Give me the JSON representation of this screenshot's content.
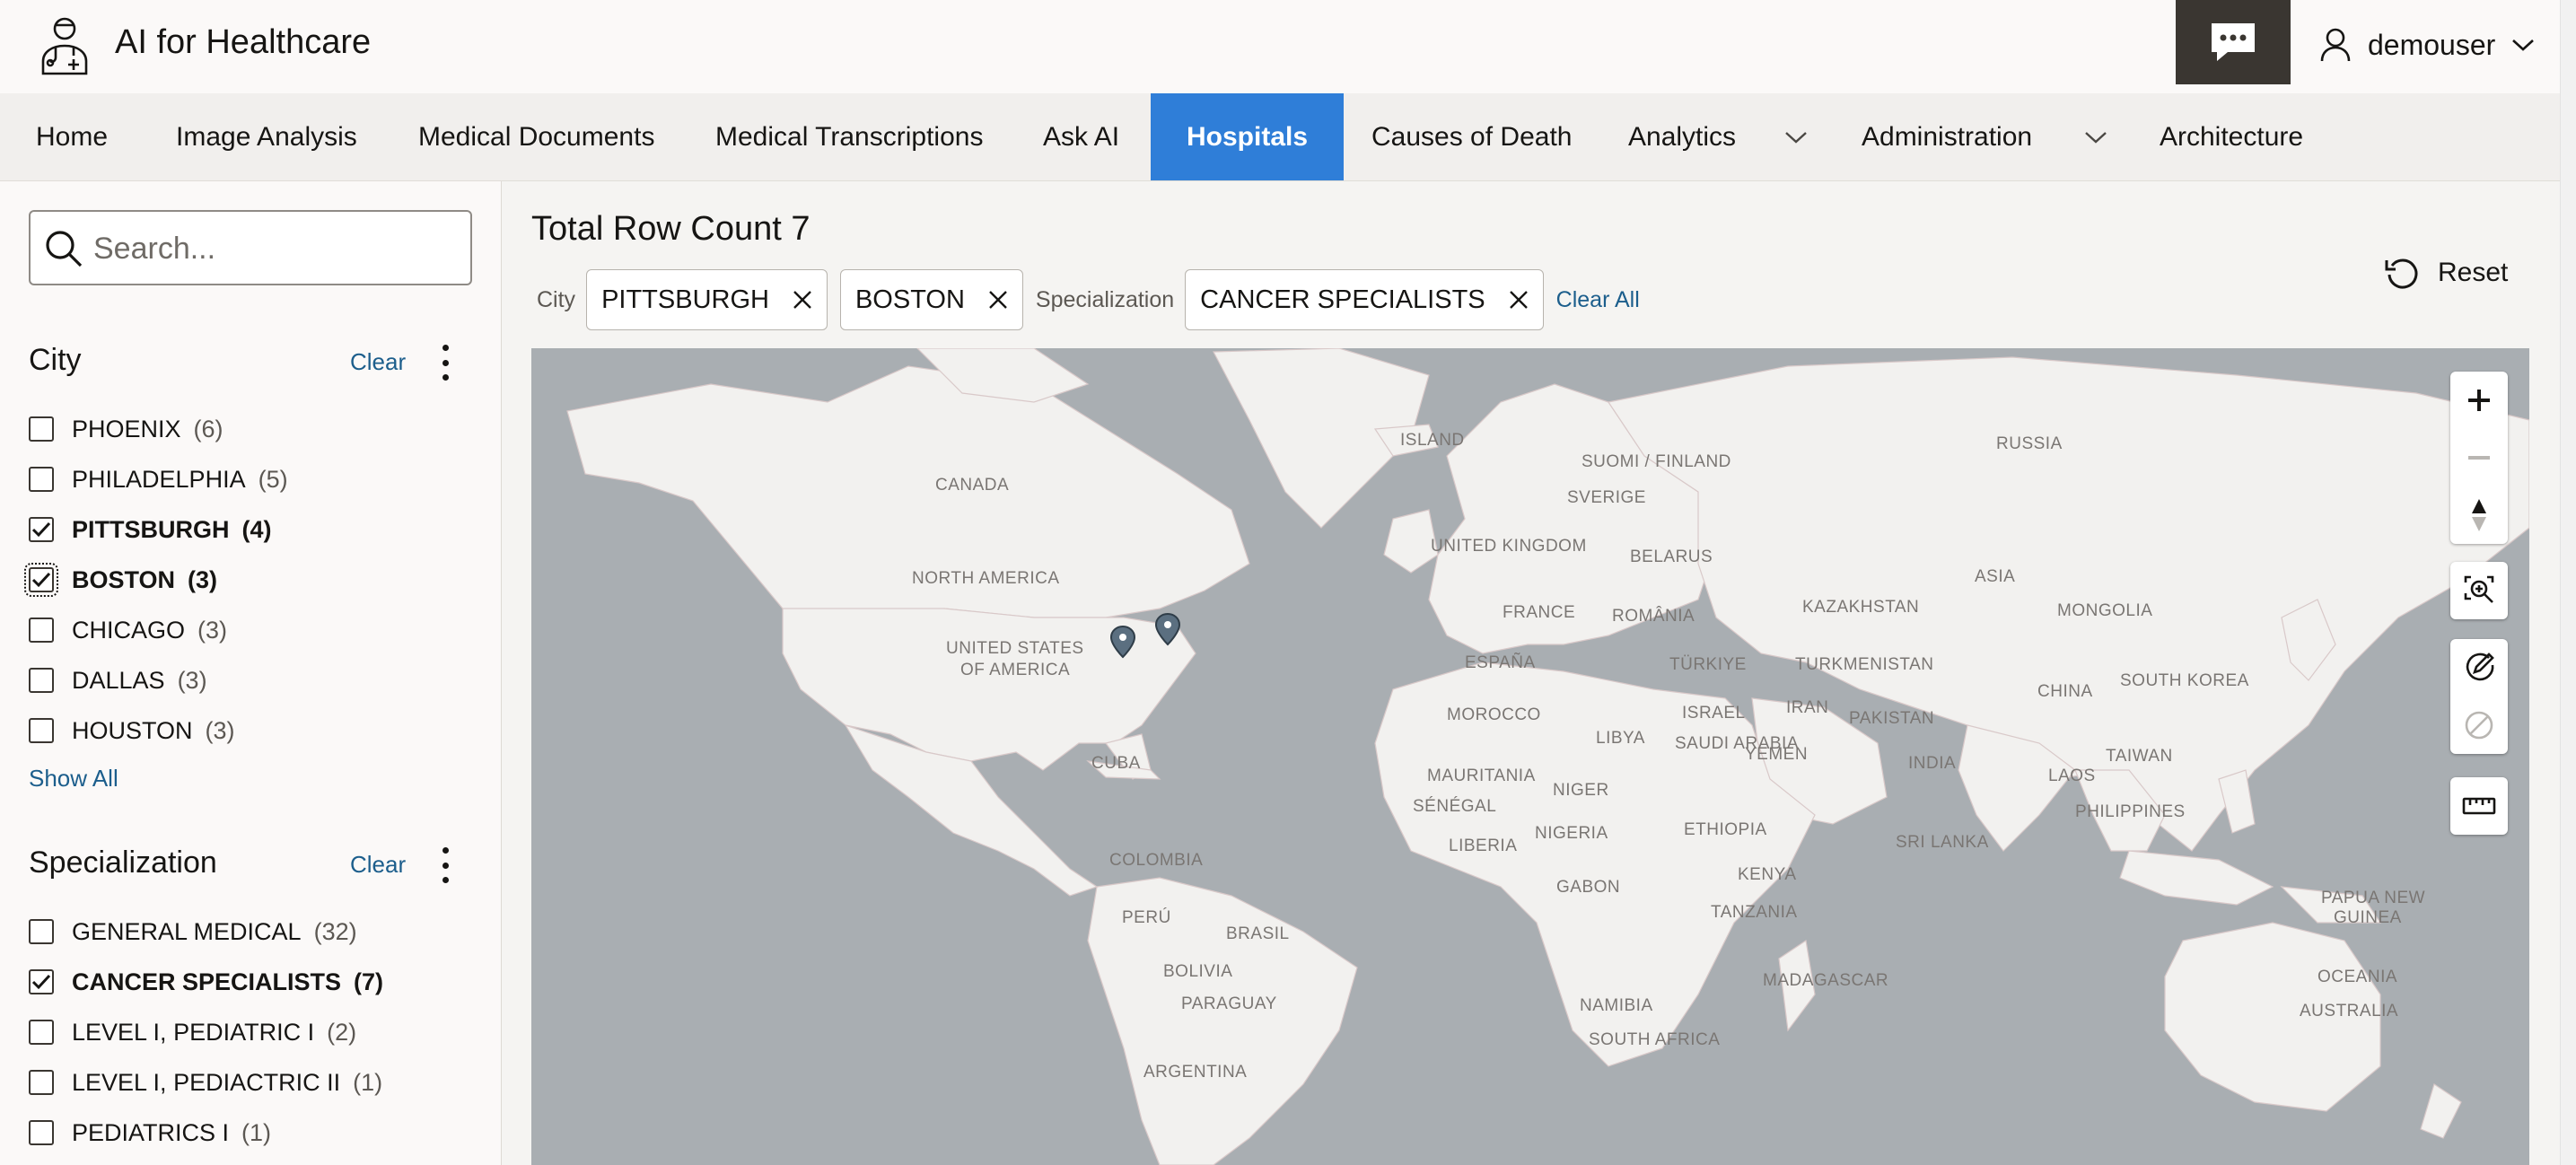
{
  "header": {
    "app_title": "AI for Healthcare",
    "user_name": "demouser",
    "logo_icon": "doctor-icon",
    "chat_icon": "chat-bubble-icon"
  },
  "nav": {
    "items": [
      {
        "label": "Home"
      },
      {
        "label": "Image Analysis"
      },
      {
        "label": "Medical Documents"
      },
      {
        "label": "Medical Transcriptions"
      },
      {
        "label": "Ask AI"
      },
      {
        "label": "Hospitals",
        "active": true
      },
      {
        "label": "Causes of Death"
      },
      {
        "label": "Analytics",
        "has_dropdown": true
      },
      {
        "label": "Administration",
        "has_dropdown": true
      },
      {
        "label": "Architecture"
      }
    ]
  },
  "sidebar": {
    "search_placeholder": "Search...",
    "city": {
      "title": "City",
      "clear_label": "Clear",
      "show_all_label": "Show All",
      "items": [
        {
          "label": "PHOENIX",
          "count": "(6)",
          "checked": false
        },
        {
          "label": "PHILADELPHIA",
          "count": "(5)",
          "checked": false
        },
        {
          "label": "PITTSBURGH",
          "count": "(4)",
          "checked": true
        },
        {
          "label": "BOSTON",
          "count": "(3)",
          "checked": true
        },
        {
          "label": "CHICAGO",
          "count": "(3)",
          "checked": false
        },
        {
          "label": "DALLAS",
          "count": "(3)",
          "checked": false
        },
        {
          "label": "HOUSTON",
          "count": "(3)",
          "checked": false
        }
      ]
    },
    "specialization": {
      "title": "Specialization",
      "clear_label": "Clear",
      "items": [
        {
          "label": "GENERAL MEDICAL",
          "count": "(32)",
          "checked": false
        },
        {
          "label": "CANCER SPECIALISTS",
          "count": "(7)",
          "checked": true
        },
        {
          "label": "LEVEL I, PEDIATRIC I",
          "count": "(2)",
          "checked": false
        },
        {
          "label": "LEVEL I, PEDIACTRIC II",
          "count": "(1)",
          "checked": false
        },
        {
          "label": "PEDIATRICS I",
          "count": "(1)",
          "checked": false
        }
      ]
    }
  },
  "main": {
    "row_count": "Total Row Count 7",
    "filters": {
      "city_label": "City",
      "city_chips": [
        "PITTSBURGH",
        "BOSTON"
      ],
      "spec_label": "Specialization",
      "spec_chips": [
        "CANCER SPECIALISTS"
      ],
      "clear_all_label": "Clear All"
    },
    "reset_label": "Reset"
  },
  "map": {
    "labels": [
      "ISLAND",
      "RUSSIA",
      "SUOMI / FINLAND",
      "SVERIGE",
      "CANADA",
      "UNITED KINGDOM",
      "BELARUS",
      "NORTH AMERICA",
      "ASIA",
      "KAZAKHSTAN",
      "MONGOLIA",
      "FRANCE",
      "ROMÂNIA",
      "UNITED STATES",
      "OF AMERICA",
      "ESPAÑA",
      "TÜRKIYE",
      "TURKMENISTAN",
      "SOUTH KOREA",
      "MOROCCO",
      "ISRAEL",
      "IRAN",
      "PAKISTAN",
      "CHINA",
      "LIBYA",
      "SAUDI ARABIA",
      "INDIA",
      "TAIWAN",
      "CUBA",
      "MAURITANIA",
      "NIGER",
      "YEMEN",
      "LAOS",
      "SÉNÉGAL",
      "ETHIOPIA",
      "PHILIPPINES",
      "LIBERIA",
      "NIGERIA",
      "SRI LANKA",
      "COLOMBIA",
      "KENYA",
      "GABON",
      "PERÚ",
      "TANZANIA",
      "PAPUA NEW",
      "GUINEA",
      "BRASIL",
      "BOLIVIA",
      "MADAGASCAR",
      "OCEANIA",
      "PARAGUAY",
      "NAMIBIA",
      "AUSTRALIA",
      "SOUTH AFRICA",
      "ARGENTINA"
    ],
    "markers": [
      "pittsburgh-marker",
      "boston-marker"
    ]
  }
}
